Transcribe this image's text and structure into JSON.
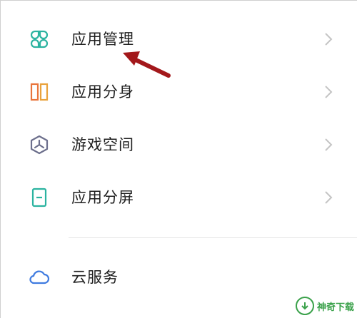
{
  "settings_list": {
    "items": [
      {
        "label": "应用管理",
        "icon": "app-grid-icon",
        "has_chevron": true
      },
      {
        "label": "应用分身",
        "icon": "app-clone-icon",
        "has_chevron": true
      },
      {
        "label": "游戏空间",
        "icon": "game-space-icon",
        "has_chevron": true
      },
      {
        "label": "应用分屏",
        "icon": "split-screen-icon",
        "has_chevron": true
      },
      {
        "label": "云服务",
        "icon": "cloud-icon",
        "has_chevron": false
      }
    ]
  },
  "colors": {
    "teal_icon": "#2bb3a0",
    "clone_orange": "#e9743b",
    "clone_blue": "#3f7be0",
    "game_icon": "#6c6f8c",
    "cloud_icon": "#3f7be0",
    "chevron": "#c4c4c4",
    "annotation_arrow": "#a3181b",
    "watermark_green": "#3aa14a"
  },
  "watermark": {
    "text": "神奇下载"
  }
}
